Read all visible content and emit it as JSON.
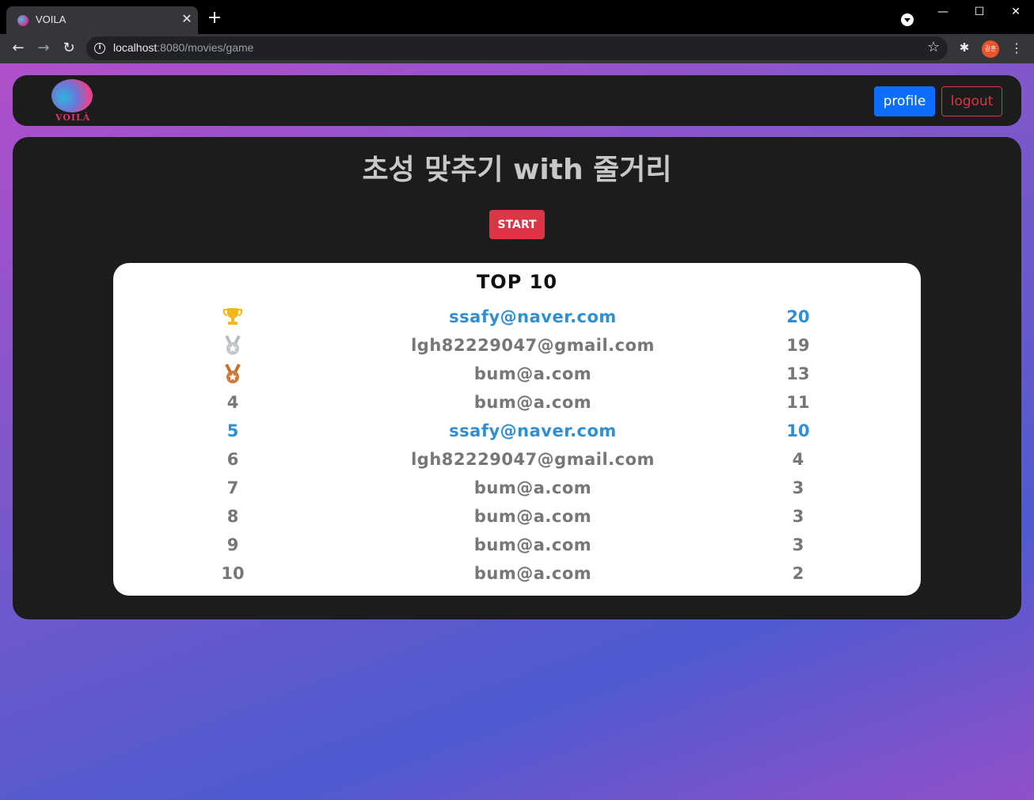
{
  "browser": {
    "tab_title": "VOILA",
    "url_host": "localhost",
    "url_path": ":8080/movies/game",
    "avatar_text": "광훈"
  },
  "navbar": {
    "logo_text": "VOILÀ",
    "profile_label": "profile",
    "logout_label": "logout"
  },
  "game": {
    "title": "초성 맞추기 with 줄거리",
    "start_label": "START"
  },
  "ranking": {
    "title": "TOP 10",
    "rows": [
      {
        "rank": "trophy-icon",
        "email": "ssafy@naver.com",
        "score": "20",
        "highlight": true
      },
      {
        "rank": "silver-medal-icon",
        "email": "lgh82229047@gmail.com",
        "score": "19",
        "highlight": false
      },
      {
        "rank": "bronze-medal-icon",
        "email": "bum@a.com",
        "score": "13",
        "highlight": false
      },
      {
        "rank": "4",
        "email": "bum@a.com",
        "score": "11",
        "highlight": false
      },
      {
        "rank": "5",
        "email": "ssafy@naver.com",
        "score": "10",
        "highlight": true
      },
      {
        "rank": "6",
        "email": "lgh82229047@gmail.com",
        "score": "4",
        "highlight": false
      },
      {
        "rank": "7",
        "email": "bum@a.com",
        "score": "3",
        "highlight": false
      },
      {
        "rank": "8",
        "email": "bum@a.com",
        "score": "3",
        "highlight": false
      },
      {
        "rank": "9",
        "email": "bum@a.com",
        "score": "3",
        "highlight": false
      },
      {
        "rank": "10",
        "email": "bum@a.com",
        "score": "2",
        "highlight": false
      }
    ]
  },
  "colors": {
    "highlight": "#2f8fd4",
    "normal_text": "#777777",
    "start_button": "#dc3545",
    "profile_button": "#0d6efd"
  }
}
